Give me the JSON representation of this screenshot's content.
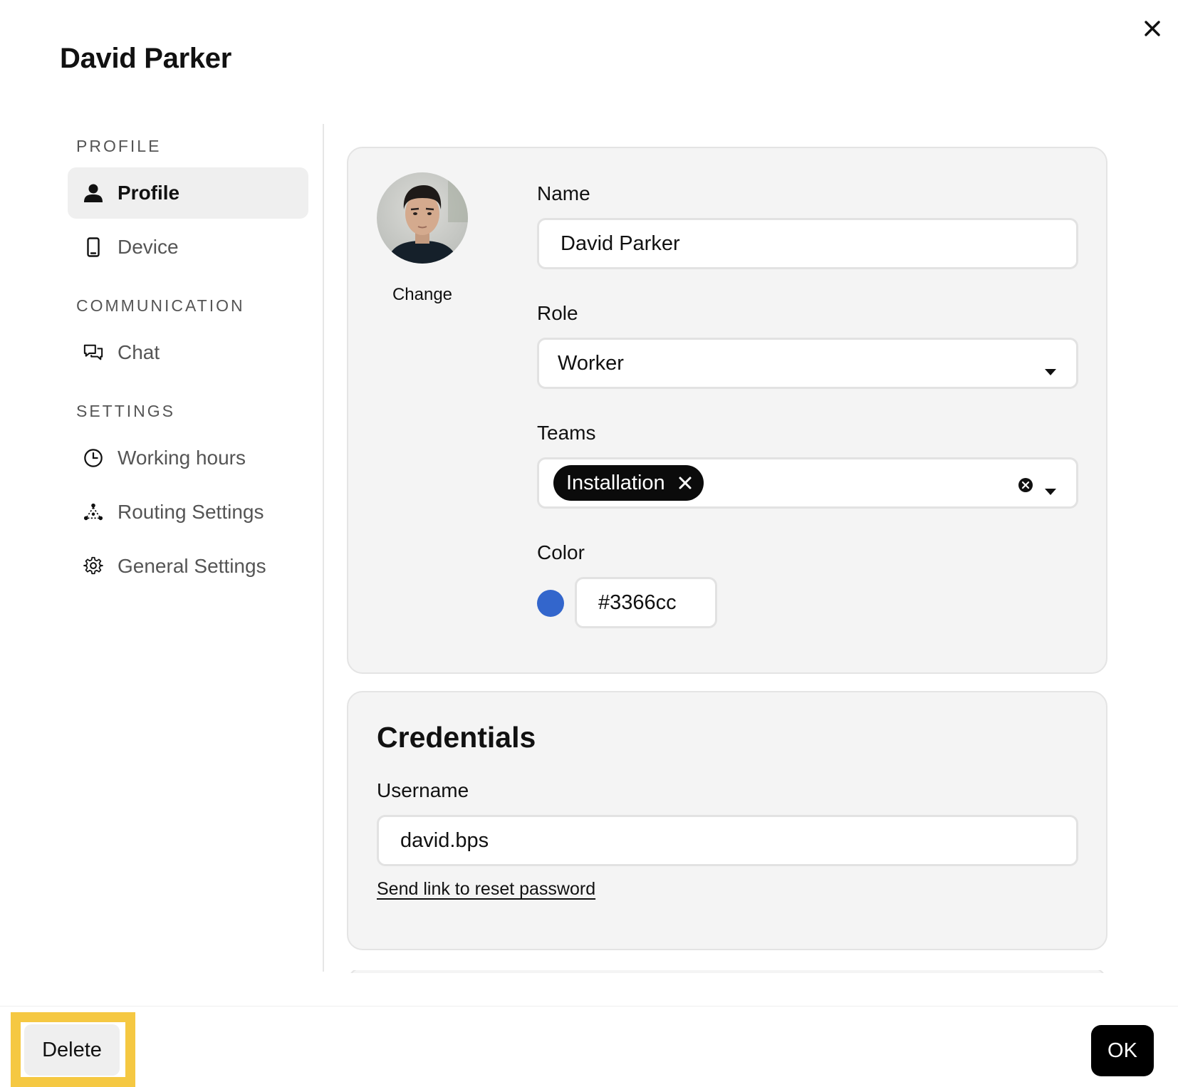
{
  "dialog": {
    "title": "David Parker"
  },
  "sidebar": {
    "sections": [
      {
        "label": "PROFILE"
      },
      {
        "label": "COMMUNICATION"
      },
      {
        "label": "SETTINGS"
      }
    ],
    "items": [
      {
        "label": "Profile",
        "icon": "person-icon",
        "active": true
      },
      {
        "label": "Device",
        "icon": "phone-icon",
        "active": false
      },
      {
        "label": "Chat",
        "icon": "chat-icon",
        "active": false
      },
      {
        "label": "Working hours",
        "icon": "clock-icon",
        "active": false
      },
      {
        "label": "Routing Settings",
        "icon": "routing-icon",
        "active": false
      },
      {
        "label": "General Settings",
        "icon": "gear-icon",
        "active": false
      }
    ]
  },
  "profile": {
    "avatar_action": "Change",
    "name_label": "Name",
    "name_value": "David Parker",
    "role_label": "Role",
    "role_value": "Worker",
    "teams_label": "Teams",
    "teams": [
      "Installation"
    ],
    "color_label": "Color",
    "color_value": "#3366cc"
  },
  "credentials": {
    "title": "Credentials",
    "username_label": "Username",
    "username_value": "david.bps",
    "reset_link": "Send link to reset password"
  },
  "footer": {
    "delete_label": "Delete",
    "ok_label": "OK"
  },
  "colors": {
    "accent": "#3366cc",
    "highlight": "#f5c842",
    "primary_button": "#000000"
  }
}
